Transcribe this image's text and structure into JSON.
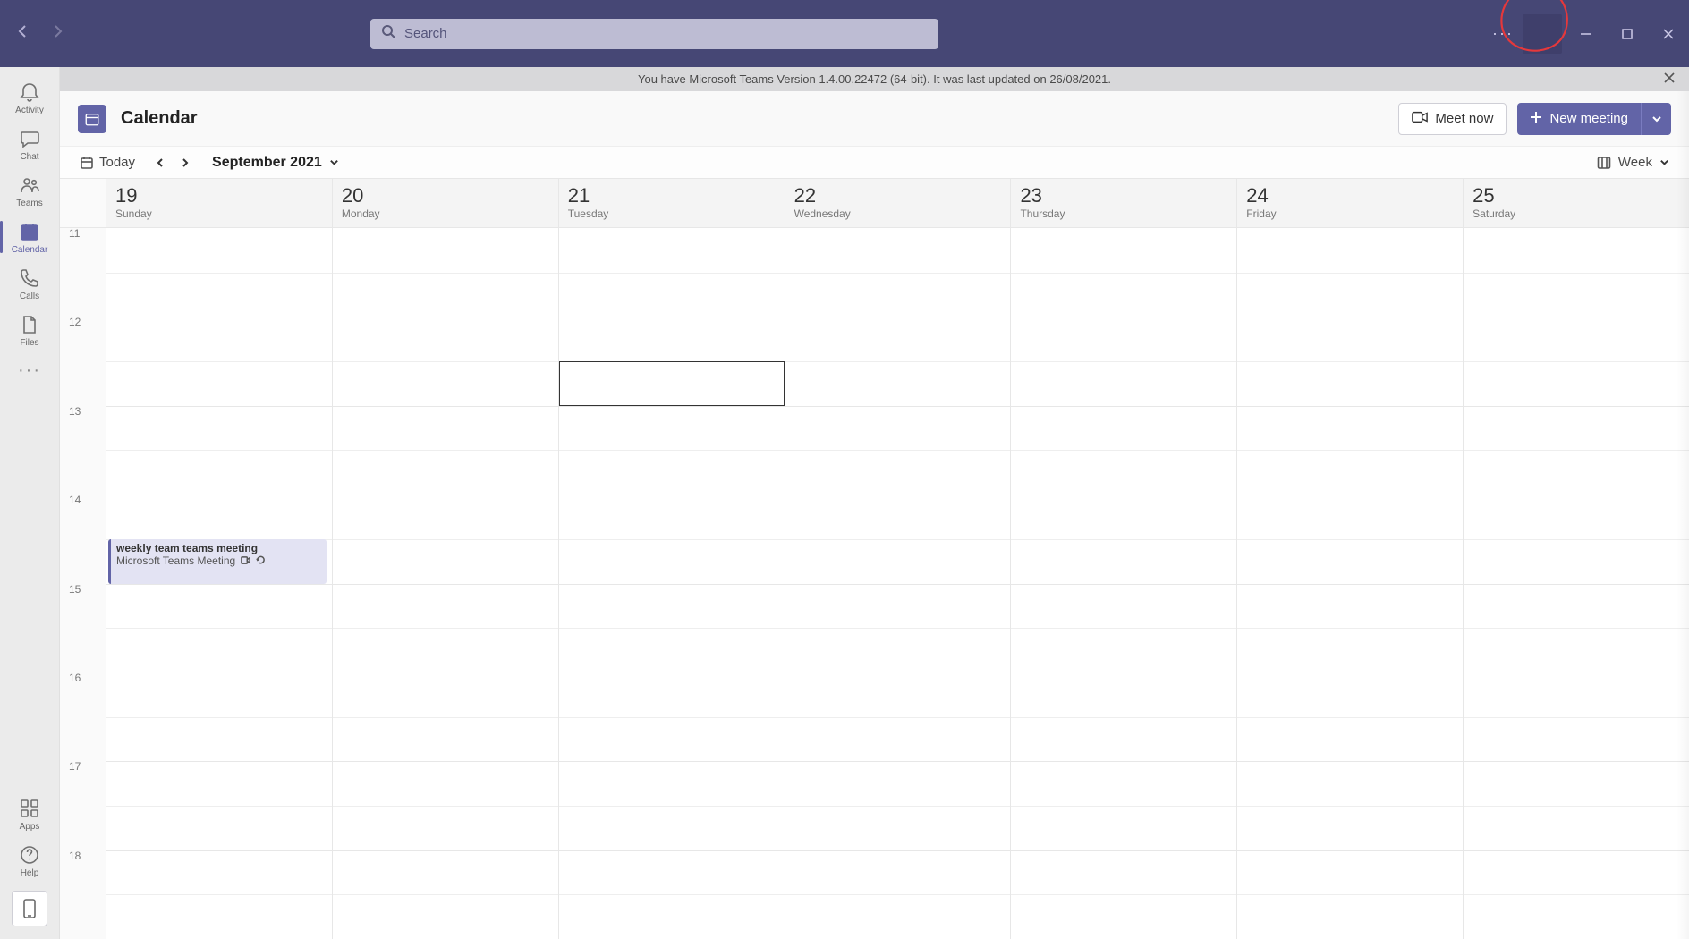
{
  "titlebar": {
    "search_placeholder": "Search"
  },
  "banner": {
    "text": "You have Microsoft Teams Version 1.4.00.22472 (64-bit). It was last updated on 26/08/2021."
  },
  "rail": {
    "items": [
      {
        "id": "activity",
        "label": "Activity"
      },
      {
        "id": "chat",
        "label": "Chat"
      },
      {
        "id": "teams",
        "label": "Teams"
      },
      {
        "id": "calendar",
        "label": "Calendar"
      },
      {
        "id": "calls",
        "label": "Calls"
      },
      {
        "id": "files",
        "label": "Files"
      }
    ],
    "apps_label": "Apps",
    "help_label": "Help"
  },
  "header": {
    "title": "Calendar",
    "meet_now": "Meet now",
    "new_meeting": "New meeting"
  },
  "toolbar": {
    "today": "Today",
    "month": "September 2021",
    "view": "Week"
  },
  "days": [
    {
      "num": "19",
      "dow": "Sunday"
    },
    {
      "num": "20",
      "dow": "Monday"
    },
    {
      "num": "21",
      "dow": "Tuesday"
    },
    {
      "num": "22",
      "dow": "Wednesday"
    },
    {
      "num": "23",
      "dow": "Thursday"
    },
    {
      "num": "24",
      "dow": "Friday"
    },
    {
      "num": "25",
      "dow": "Saturday"
    }
  ],
  "hours": [
    "11",
    "12",
    "13",
    "14",
    "15",
    "16",
    "17",
    "18"
  ],
  "events": [
    {
      "day": 0,
      "title": "weekly team teams meeting",
      "subtitle": "Microsoft Teams Meeting",
      "start_hour_index": 3.5,
      "duration_hours": 0.5,
      "recurring": true
    }
  ],
  "selection": {
    "day": 2,
    "start_hour_index": 1.5,
    "duration_hours": 0.5
  }
}
